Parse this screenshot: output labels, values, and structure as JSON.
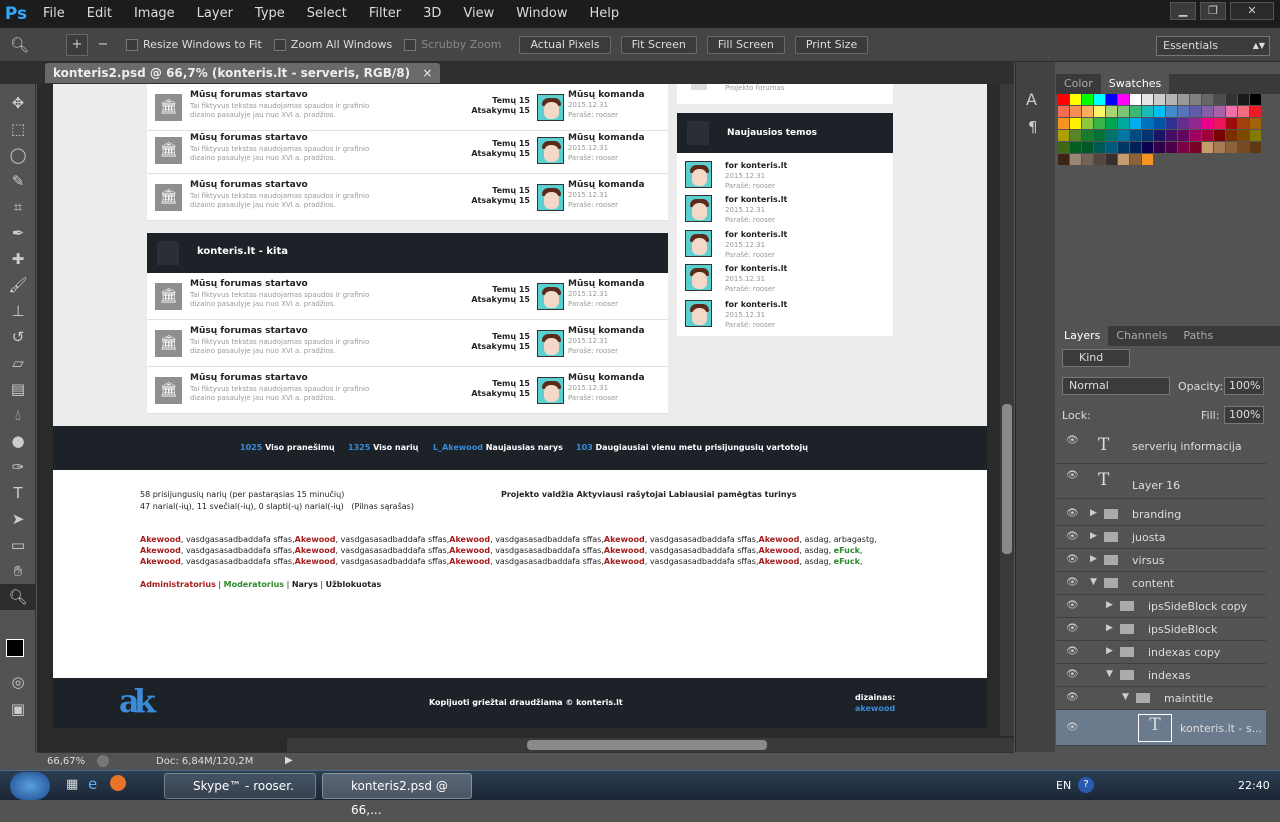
{
  "app": {
    "logo": "Ps",
    "menu": [
      "File",
      "Edit",
      "Image",
      "Layer",
      "Type",
      "Select",
      "Filter",
      "3D",
      "View",
      "Window",
      "Help"
    ]
  },
  "window_controls": {
    "minimize": "▁",
    "maximize": "❐",
    "close": "✕"
  },
  "options": {
    "zoom_in": "+",
    "zoom_out": "−",
    "resize_windows": "Resize Windows to Fit",
    "zoom_all": "Zoom All Windows",
    "scrubby": "Scrubby Zoom",
    "actual_pixels": "Actual Pixels",
    "fit_screen": "Fit Screen",
    "fill_screen": "Fill Screen",
    "print_size": "Print Size",
    "workspace": "Essentials"
  },
  "doc_tab": {
    "title": "konteris2.psd @ 66,7% (konteris.lt - serveris, RGB/8)",
    "close": "×"
  },
  "forum": {
    "rows_top": [
      {
        "title": "Mūsų forumas startavo",
        "desc": "Tai fiktyvus tekstas naudojamas spaudos ir grafinio dizaino pasaulyje jau nuo XVI a. pradžios.",
        "stats": "Temų 15\nAtsakymų 15",
        "last": "Mūsų komanda",
        "date": "2015.12.31",
        "by": "Parašė: rooser"
      },
      {
        "title": "Mūsų forumas startavo",
        "desc": "Tai fiktyvus tekstas naudojamas spaudos ir grafinio dizaino pasaulyje jau nuo XVI a. pradžios.",
        "stats": "Temų 15\nAtsakymų 15",
        "last": "Mūsų komanda",
        "date": "2015.12.31",
        "by": "Parašė: rooser"
      },
      {
        "title": "Mūsų forumas startavo",
        "desc": "Tai fiktyvus tekstas naudojamas spaudos ir grafinio dizaino pasaulyje jau nuo XVI a. pradžios.",
        "stats": "Temų 15\nAtsakymų 15",
        "last": "Mūsų komanda",
        "date": "2015.12.31",
        "by": "Parašė: rooser"
      }
    ],
    "section2_title": "konteris.lt - kita",
    "rows_bottom": [
      {
        "title": "Mūsų forumas startavo",
        "desc": "Tai fiktyvus tekstas naudojamas spaudos ir grafinio dizaino pasaulyje jau nuo XVI a. pradžios.",
        "stats": "Temų 15\nAtsakymų 15",
        "last": "Mūsų komanda",
        "date": "2015.12.31",
        "by": "Parašė: rooser"
      },
      {
        "title": "Mūsų forumas startavo",
        "desc": "Tai fiktyvus tekstas naudojamas spaudos ir grafinio dizaino pasaulyje jau nuo XVI a. pradžios.",
        "stats": "Temų 15\nAtsakymų 15",
        "last": "Mūsų komanda",
        "date": "2015.12.31",
        "by": "Parašė: rooser"
      },
      {
        "title": "Mūsų forumas startavo",
        "desc": "Tai fiktyvus tekstas naudojamas spaudos ir grafinio dizaino pasaulyje jau nuo XVI a. pradžios.",
        "stats": "Temų 15\nAtsakymų 15",
        "last": "Mūsų komanda",
        "date": "2015.12.31",
        "by": "Parašė: rooser"
      }
    ],
    "side_top_label": "Projekto forumas",
    "latest_title": "Naujausios temos",
    "latest": [
      {
        "title": "for konteris.lt",
        "date": "2015.12.31",
        "by": "Parašė: rooser"
      },
      {
        "title": "for konteris.lt",
        "date": "2015.12.31",
        "by": "Parašė: rooser"
      },
      {
        "title": "for konteris.lt",
        "date": "2015.12.31",
        "by": "Parašė: rooser"
      },
      {
        "title": "for konteris.lt",
        "date": "2015.12.31",
        "by": "Parašė: rooser"
      },
      {
        "title": "for konteris.lt",
        "date": "2015.12.31",
        "by": "Parašė: rooser"
      }
    ],
    "stats": {
      "n1": "1025",
      "l1": "Viso pranešimų",
      "n2": "1325",
      "l2": "Viso narių",
      "n3": "L_Akewood",
      "l3": "Naujausias narys",
      "n4": "103",
      "l4": "Daugiausiai vienu metu prisijungusių vartotojų"
    },
    "online": {
      "line1": "58 prisijungusių narių (per pastarąsias 15 minučių)",
      "line2": "47 narial(-ių), 11 svečial(-ių), 0 slapti(-ų) narial(-ių)",
      "full_list": "(Pilnas sąrašas)",
      "links": "Projekto valdžia  Aktyviausi rašytojai  Labiausiai pamėgtas turinys",
      "names_name": "Akewood",
      "names_filler": "vasdgasasadbaddafa sffas",
      "names_efuck": "eFuck",
      "names_asdag": "asdag",
      "names_line1_tail": "asdag, arbagastg,"
    },
    "legend": {
      "admin": "Administratorius",
      "mod": "Moderatorius",
      "member": "Narys",
      "blocked": "Užblokuotas"
    },
    "footer": {
      "logo": "ak",
      "copyright": "Kopijuoti griežtai draudžiama © konteris.lt",
      "design_label": "dizainas:",
      "design_by": "akewood"
    }
  },
  "status": {
    "zoom": "66,67%",
    "doc": "Doc: 6,84M/120,2M"
  },
  "panels": {
    "color_tabs": [
      "Color",
      "Swatches"
    ],
    "layer_tabs": [
      "Layers",
      "Channels",
      "Paths"
    ],
    "kind": "Kind",
    "blend": "Normal",
    "opacity_label": "Opacity:",
    "opacity": "100%",
    "lock_label": "Lock:",
    "fill_label": "Fill:",
    "fill": "100%",
    "layers": [
      "serverių informacija",
      "Layer 16",
      "branding",
      "juosta",
      "virsus",
      "content",
      "ipsSideBlock copy",
      "ipsSideBlock",
      "indexas copy",
      "indexas",
      "maintitle",
      "konteris.lt - s..."
    ]
  },
  "taskbar": {
    "skype": "Skype™ - rooser.",
    "ps": "konteris2.psd @ 66,...",
    "lang": "EN",
    "clock": "22:40"
  }
}
